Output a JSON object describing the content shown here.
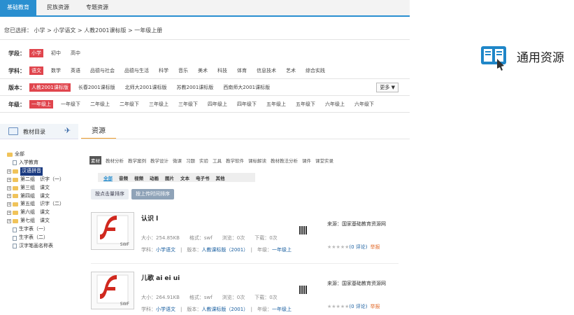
{
  "nav": {
    "tabs": [
      {
        "label": "基础教育"
      },
      {
        "label": "民族资源"
      },
      {
        "label": "专题资源"
      }
    ]
  },
  "breadcrumb": "您已选择： 小学 > 小学语文 > 人教2001课标版 > 一年级上册",
  "filters": {
    "stage": {
      "label": "学段：",
      "options": [
        "小学",
        "初中",
        "高中"
      ]
    },
    "subject": {
      "label": "学科：",
      "options": [
        "语文",
        "数学",
        "英语",
        "品德与社会",
        "品德与生活",
        "科学",
        "音乐",
        "美术",
        "科技",
        "体育",
        "信息技术",
        "艺术",
        "综合实践"
      ]
    },
    "edition": {
      "label": "版本：",
      "options": [
        "人教2001课标版",
        "长春2001课标版",
        "北师大2001课标版",
        "苏教2001课标版",
        "西南师大2001课标版"
      ]
    },
    "grade": {
      "label": "年级：",
      "options": [
        "一年级上",
        "一年级下",
        "二年级上",
        "二年级下",
        "三年级上",
        "三年级下",
        "四年级上",
        "四年级下",
        "五年级上",
        "五年级下",
        "六年级上",
        "六年级下"
      ]
    },
    "more": "更多 ▼"
  },
  "sidebar": {
    "title": "教材目录",
    "tree": [
      {
        "label": "全部",
        "kind": "root"
      },
      {
        "label": "入学教育",
        "kind": "doc"
      },
      {
        "label": "汉语拼音",
        "kind": "folder",
        "selected": true
      },
      {
        "label": "第二组　识字（一）",
        "kind": "folder"
      },
      {
        "label": "第三组　课文",
        "kind": "folder"
      },
      {
        "label": "第四组　课文",
        "kind": "folder"
      },
      {
        "label": "第五组　识字（二）",
        "kind": "folder"
      },
      {
        "label": "第六组　课文",
        "kind": "folder"
      },
      {
        "label": "第七组　课文",
        "kind": "folder"
      },
      {
        "label": "生字表（一）",
        "kind": "doc"
      },
      {
        "label": "生字表（二）",
        "kind": "doc"
      },
      {
        "label": "汉字笔画名称表",
        "kind": "doc"
      }
    ]
  },
  "resources_tab": "资源",
  "categories": [
    "素材",
    "教材分析",
    "教学案例",
    "教学设计",
    "微课",
    "习题",
    "实验",
    "工具",
    "教学软件",
    "课标解读",
    "教材教法分析",
    "课件",
    "课堂实录"
  ],
  "types": [
    "全部",
    "音频",
    "视频",
    "动画",
    "图片",
    "文本",
    "电子书",
    "其他"
  ],
  "sort": {
    "downloads": "按点击量排序",
    "latest": "按上传时间排序"
  },
  "resources": [
    {
      "title": "认识 l",
      "size_label": "大小：",
      "size": "254.85KB",
      "format_label": "格式：",
      "format": "swf",
      "views_label": "浏览：",
      "views": "0次",
      "downloads_label": "下载：",
      "downloads": "0次",
      "subject_label": "学科：",
      "subject": "小学语文",
      "version_label": "版本：",
      "version": "人教课标版（2001）",
      "grade_label": "年级：",
      "grade": "一年级上",
      "source": "来源：国家基础教育资源网",
      "comments": "(0 评论)",
      "report": "举报",
      "thumb_label": "SWF"
    },
    {
      "title": "儿歌 ai ei ui",
      "size_label": "大小：",
      "size": "264.91KB",
      "format_label": "格式：",
      "format": "swf",
      "views_label": "浏览：",
      "views": "0次",
      "downloads_label": "下载：",
      "downloads": "0次",
      "subject_label": "学科：",
      "subject": "小学语文",
      "version_label": "版本：",
      "version": "人教课标版（2001）",
      "grade_label": "年级：",
      "grade": "一年级上",
      "source": "来源：国家基础教育资源网",
      "comments": "(0 评论)",
      "report": "举报",
      "thumb_label": "SWF"
    }
  ],
  "side_banner": {
    "label": "通用资源"
  },
  "colors": {
    "accent": "#2a8fd0",
    "selected": "#e0454d",
    "link": "#1a5fa0"
  }
}
